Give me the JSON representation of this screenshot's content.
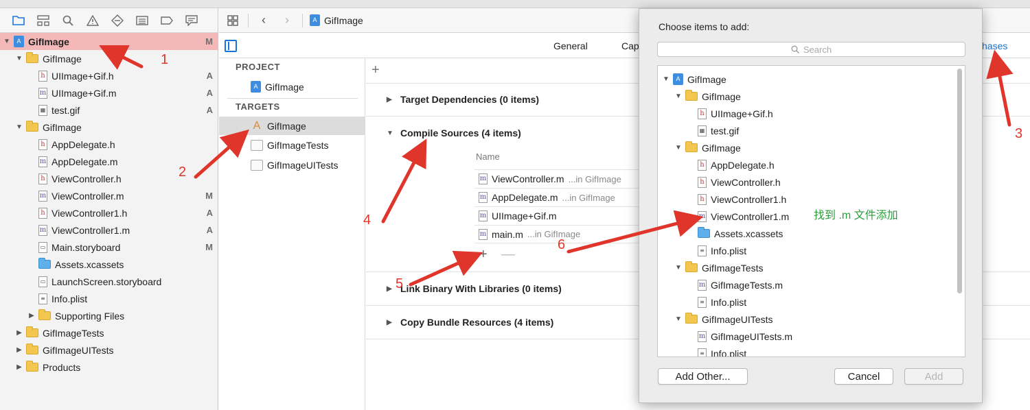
{
  "navigator": {
    "tabs": [
      "folder-icon",
      "hierarchy-icon",
      "search-icon",
      "warning-icon",
      "test-icon",
      "debug-icon",
      "breakpoint-icon",
      "report-icon"
    ],
    "tree": [
      {
        "label": "GifImage",
        "status": "M",
        "indent": 0,
        "disc": "open",
        "icon": "project",
        "selected": true
      },
      {
        "label": "GifImage",
        "status": "",
        "indent": 1,
        "disc": "open",
        "icon": "folder"
      },
      {
        "label": "UIImage+Gif.h",
        "status": "A",
        "indent": 2,
        "icon": "h"
      },
      {
        "label": "UIImage+Gif.m",
        "status": "A",
        "indent": 2,
        "icon": "m"
      },
      {
        "label": "test.gif",
        "status": "A",
        "indent": 2,
        "icon": "gif"
      },
      {
        "label": "GifImage",
        "status": "",
        "indent": 1,
        "disc": "open",
        "icon": "folder"
      },
      {
        "label": "AppDelegate.h",
        "status": "",
        "indent": 2,
        "icon": "h"
      },
      {
        "label": "AppDelegate.m",
        "status": "",
        "indent": 2,
        "icon": "m"
      },
      {
        "label": "ViewController.h",
        "status": "",
        "indent": 2,
        "icon": "h"
      },
      {
        "label": "ViewController.m",
        "status": "M",
        "indent": 2,
        "icon": "m"
      },
      {
        "label": "ViewController1.h",
        "status": "A",
        "indent": 2,
        "icon": "h"
      },
      {
        "label": "ViewController1.m",
        "status": "A",
        "indent": 2,
        "icon": "m"
      },
      {
        "label": "Main.storyboard",
        "status": "M",
        "indent": 2,
        "icon": "storyboard"
      },
      {
        "label": "Assets.xcassets",
        "status": "",
        "indent": 2,
        "icon": "bluefolder"
      },
      {
        "label": "LaunchScreen.storyboard",
        "status": "",
        "indent": 2,
        "icon": "storyboard"
      },
      {
        "label": "Info.plist",
        "status": "",
        "indent": 2,
        "icon": "plist"
      },
      {
        "label": "Supporting Files",
        "status": "",
        "indent": 2,
        "disc": "closed",
        "icon": "folder"
      },
      {
        "label": "GifImageTests",
        "status": "",
        "indent": 1,
        "disc": "closed",
        "icon": "folder"
      },
      {
        "label": "GifImageUITests",
        "status": "",
        "indent": 1,
        "disc": "closed",
        "icon": "folder"
      },
      {
        "label": "Products",
        "status": "",
        "indent": 1,
        "disc": "closed",
        "icon": "folder"
      }
    ]
  },
  "editor": {
    "breadcrumb": "GifImage",
    "settings_tabs": {
      "general": "General",
      "capabilities": "Cap",
      "build_phases": "hases"
    },
    "project_header": "PROJECT",
    "project_item": "GifImage",
    "targets_header": "TARGETS",
    "targets": [
      "GifImage",
      "GifImageTests",
      "GifImageUITests"
    ],
    "phases": {
      "target_dependencies": "Target Dependencies (0 items)",
      "compile_sources": "Compile Sources (4 items)",
      "column_name": "Name",
      "sources": [
        {
          "name": "ViewController.m",
          "path": "...in GifImage"
        },
        {
          "name": "AppDelegate.m",
          "path": "...in GifImage"
        },
        {
          "name": "UIImage+Gif.m",
          "path": ""
        },
        {
          "name": "main.m",
          "path": "...in GifImage"
        }
      ],
      "add_symbol": "+",
      "remove_symbol": "—",
      "link_binary": "Link Binary With Libraries (0 items)",
      "copy_bundle": "Copy Bundle Resources (4 items)"
    }
  },
  "sheet": {
    "title": "Choose items to add:",
    "search_placeholder": "Search",
    "items": [
      {
        "label": "GifImage",
        "indent": 0,
        "disc": "open",
        "icon": "project"
      },
      {
        "label": "GifImage",
        "indent": 1,
        "disc": "open",
        "icon": "folder"
      },
      {
        "label": "UIImage+Gif.h",
        "indent": 2,
        "icon": "h"
      },
      {
        "label": "test.gif",
        "indent": 2,
        "icon": "gif"
      },
      {
        "label": "GifImage",
        "indent": 1,
        "disc": "open",
        "icon": "folder"
      },
      {
        "label": "AppDelegate.h",
        "indent": 2,
        "icon": "h"
      },
      {
        "label": "ViewController.h",
        "indent": 2,
        "icon": "h"
      },
      {
        "label": "ViewController1.h",
        "indent": 2,
        "icon": "h"
      },
      {
        "label": "ViewController1.m",
        "indent": 2,
        "icon": "m"
      },
      {
        "label": "Assets.xcassets",
        "indent": 2,
        "icon": "bluefolder"
      },
      {
        "label": "Info.plist",
        "indent": 2,
        "icon": "plist"
      },
      {
        "label": "GifImageTests",
        "indent": 1,
        "disc": "open",
        "icon": "folder"
      },
      {
        "label": "GifImageTests.m",
        "indent": 2,
        "icon": "m"
      },
      {
        "label": "Info.plist",
        "indent": 2,
        "icon": "plist"
      },
      {
        "label": "GifImageUITests",
        "indent": 1,
        "disc": "open",
        "icon": "folder"
      },
      {
        "label": "GifImageUITests.m",
        "indent": 2,
        "icon": "m"
      },
      {
        "label": "Info.plist",
        "indent": 2,
        "icon": "plist"
      }
    ],
    "add_other": "Add Other...",
    "cancel": "Cancel",
    "add": "Add"
  },
  "annotations": {
    "step1": "1",
    "step2": "2",
    "step3": "3",
    "step4": "4",
    "step5": "5",
    "step6": "6",
    "note": "找到 .m 文件添加",
    "arrow_color": "#e0352a",
    "note_color": "#2a9d3a"
  }
}
